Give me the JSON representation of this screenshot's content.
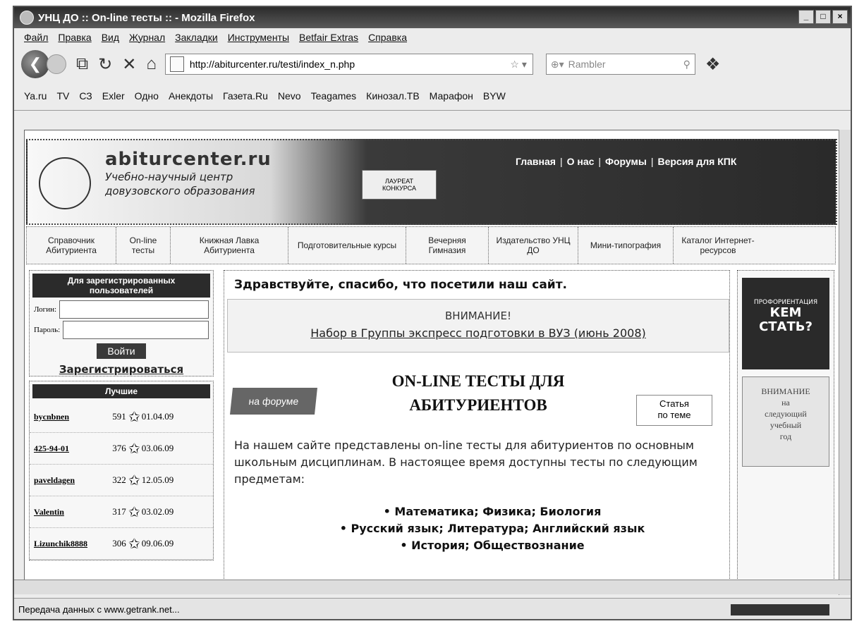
{
  "window": {
    "title": "УНЦ ДО :: On-line тесты :: - Mozilla Firefox"
  },
  "menu": [
    "Файл",
    "Правка",
    "Вид",
    "Журнал",
    "Закладки",
    "Инструменты",
    "Betfair Extras",
    "Справка"
  ],
  "nav": {
    "url": "http://abiturcenter.ru/testi/index_n.php",
    "search_placeholder": "Rambler"
  },
  "bookmarks": [
    "Ya.ru",
    "TV",
    "СЗ",
    "Exler",
    "Одно",
    "Анекдоты",
    "Газета.Ru",
    "Nevo",
    "Teagames",
    "Кинозал.ТВ",
    "Марафон",
    "BYW"
  ],
  "status": "Передача данных с www.getrank.net...",
  "site": {
    "logo_title": "abiturcenter.ru",
    "logo_sub1": "Учебно-научный центр",
    "logo_sub2": "довузовского образования",
    "award_line1": "ЛАУРЕАТ",
    "award_line2": "КОНКУРСА",
    "topnav": [
      "Главная",
      "О нас",
      "Форумы",
      "Версия для КПК"
    ],
    "catnav": [
      "Справочник Абитуриента",
      "On-line тесты",
      "Книжная Лавка Абитуриента",
      "Подготовительные курсы",
      "Вечерняя Гимназия",
      "Издательство УНЦ ДО",
      "Мини-типография",
      "Каталог Интернет-ресурсов"
    ]
  },
  "login": {
    "heading": "Для зарегистрированных пользователей",
    "login_label": "Логин:",
    "password_label": "Пароль:",
    "submit": "Войти",
    "register": "Зарегистрироваться"
  },
  "best": {
    "heading": "Лучшие",
    "rows": [
      {
        "name": "bycnbnen",
        "count": "591",
        "date": "01.04.09"
      },
      {
        "name": "425-94-01",
        "count": "376",
        "date": "03.06.09"
      },
      {
        "name": "paveldagen",
        "count": "322",
        "date": "12.05.09"
      },
      {
        "name": "Valentin",
        "count": "317",
        "date": "03.02.09"
      },
      {
        "name": "Lizunchik8888",
        "count": "306",
        "date": "09.06.09"
      }
    ]
  },
  "content": {
    "welcome": "Здравствуйте, спасибо, что посетили наш сайт.",
    "attention_title": "ВНИМАНИЕ!",
    "attention_link": "Набор в Группы экспресс подготовки в ВУЗ (июнь 2008)",
    "forum_button": "на форуме",
    "tests_title_1": "ON-LINE ТЕСТЫ ДЛЯ",
    "tests_title_2": "АБИТУРИЕНТОВ",
    "article_1": "Статья",
    "article_2": "по теме",
    "intro": "На нашем сайте представлены on-line тесты для абитуриентов по основным школьным дисциплинам. В настоящее время доступны тесты по следующим предметам:",
    "subjects": [
      "Математика; Физика; Биология",
      "Русский язык; Литература; Английский язык",
      "История; Обществознание"
    ]
  },
  "right": {
    "banner_small": "ПРОФОРИЕНТАЦИЯ",
    "banner_line1": "КЕМ",
    "banner_line2": "СТАТЬ?",
    "notice_1": "ВНИМАНИЕ",
    "notice_2": "на",
    "notice_3": "следующий",
    "notice_4": "учебный",
    "notice_5": "год"
  }
}
